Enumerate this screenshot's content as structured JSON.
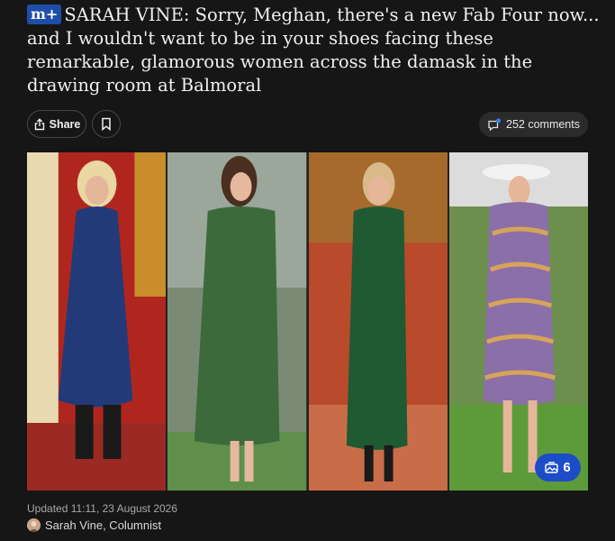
{
  "article": {
    "logo_text": "m+",
    "headline": "SARAH VINE: Sorry, Meghan, there's a new Fab Four now... and I wouldn't want to be in your shoes facing these remarkable, glamorous women across the damask in the drawing room at Balmoral",
    "updated": "Updated 11:11, 23 August 2026",
    "author": "Sarah Vine, Columnist"
  },
  "toolbar": {
    "share_label": "Share",
    "comments_label": "252 comments"
  },
  "gallery": {
    "count": "6"
  },
  "icons": {
    "share": "share-icon",
    "bookmark": "bookmark-icon",
    "comments": "comment-bubble-icon",
    "gallery": "gallery-icon"
  },
  "colors": {
    "background": "#161616",
    "logo_blue": "#1e4ea8",
    "badge_blue": "#1d4cc9",
    "notification_dot": "#3b82f6"
  }
}
